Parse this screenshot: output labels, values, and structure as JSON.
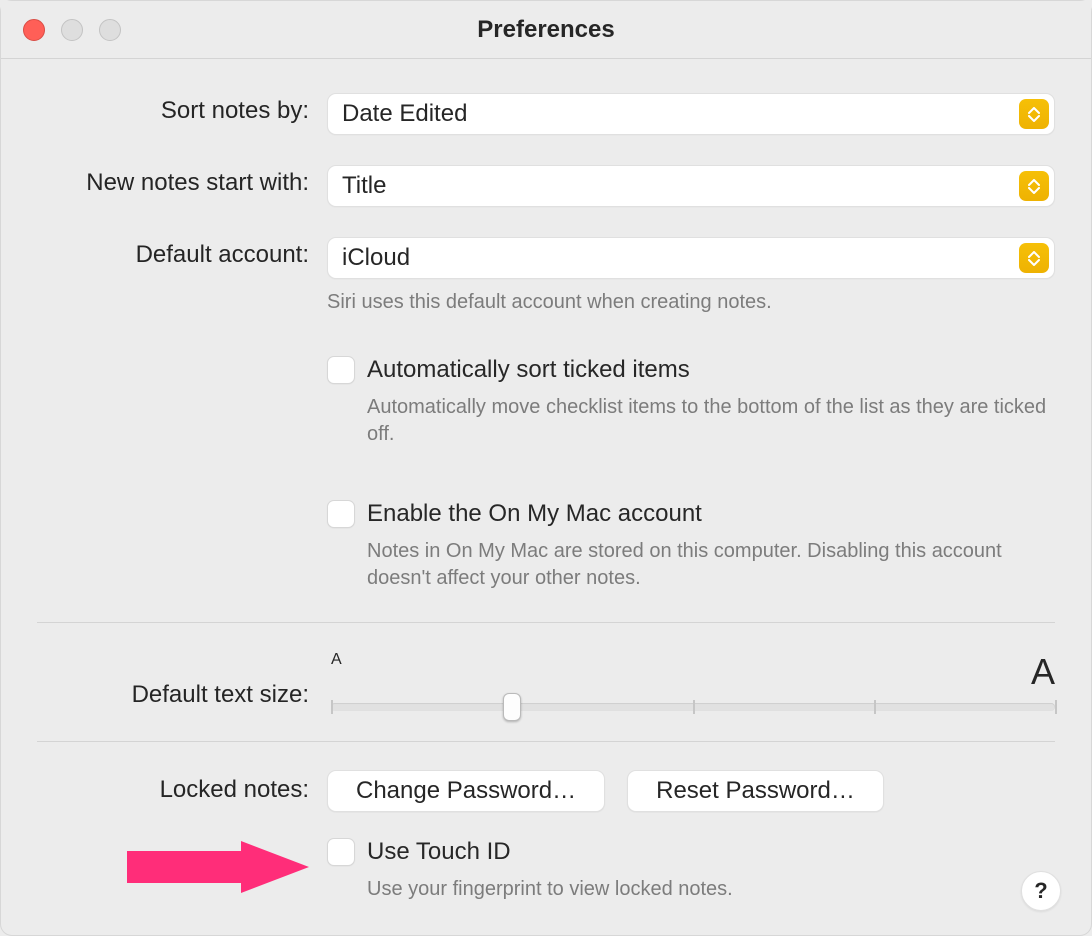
{
  "window": {
    "title": "Preferences"
  },
  "rows": {
    "sort": {
      "label": "Sort notes by:",
      "value": "Date Edited"
    },
    "start": {
      "label": "New notes start with:",
      "value": "Title"
    },
    "account": {
      "label": "Default account:",
      "value": "iCloud",
      "helper": "Siri uses this default account when creating notes."
    }
  },
  "checkboxes": {
    "autosort": {
      "label": "Automatically sort ticked items",
      "helper": "Automatically move checklist items to the bottom of the list as they are ticked off.",
      "checked": false
    },
    "onmymac": {
      "label": "Enable the On My Mac account",
      "helper": "Notes in On My Mac are stored on this computer. Disabling this account doesn't affect your other notes.",
      "checked": false
    },
    "touchid": {
      "label": "Use Touch ID",
      "helper": "Use your fingerprint to view locked notes.",
      "checked": false
    }
  },
  "slider": {
    "label": "Default text size:",
    "smallA": "A",
    "bigA": "A",
    "position_percent": 25,
    "ticks_percent": [
      0,
      25,
      50,
      75,
      100
    ]
  },
  "locked": {
    "label": "Locked notes:",
    "change": "Change Password…",
    "reset": "Reset Password…"
  },
  "help": {
    "glyph": "?"
  }
}
